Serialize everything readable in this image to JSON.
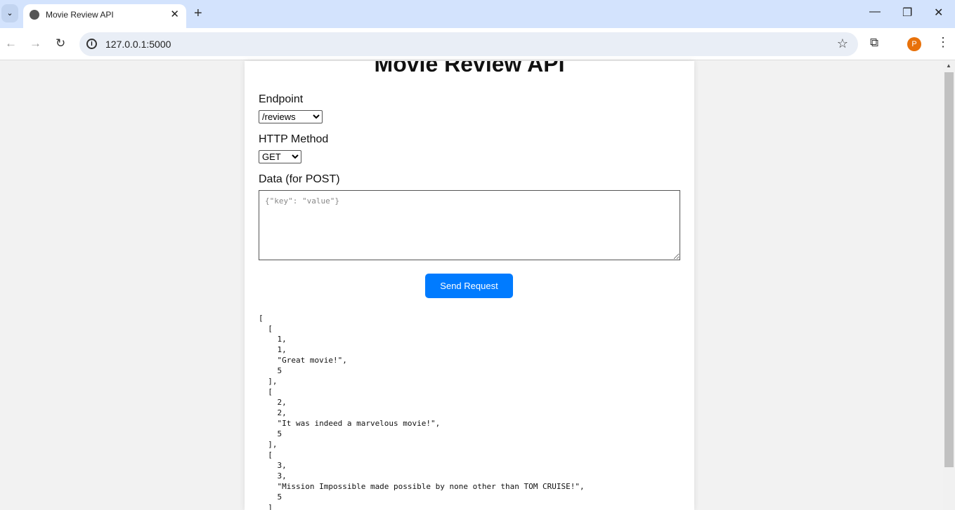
{
  "browser": {
    "tab_title": "Movie Review API",
    "url": "127.0.0.1:5000",
    "profile_initial": "P"
  },
  "page": {
    "title": "Movie Review API",
    "endpoint_label": "Endpoint",
    "endpoint_value": "/reviews",
    "method_label": "HTTP Method",
    "method_value": "GET",
    "data_label": "Data (for POST)",
    "data_placeholder": "{\"key\": \"value\"}",
    "send_label": "Send Request",
    "response": "[\n  [\n    1,\n    1,\n    \"Great movie!\",\n    5\n  ],\n  [\n    2,\n    2,\n    \"It was indeed a marvelous movie!\",\n    5\n  ],\n  [\n    3,\n    3,\n    \"Mission Impossible made possible by none other than TOM CRUISE!\",\n    5\n  ]"
  }
}
